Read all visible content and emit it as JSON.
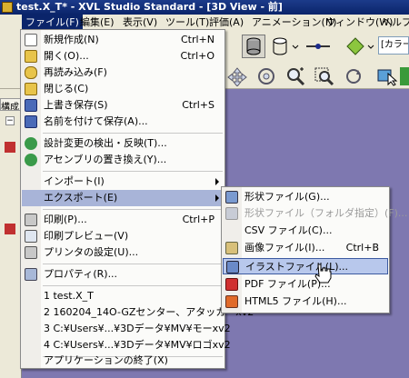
{
  "window": {
    "title": "test.X_T* - XVL Studio Standard - [3D View - 前]"
  },
  "menubar": {
    "items": [
      "ファイル(F)",
      "編集(E)",
      "表示(V)",
      "ツール(T)",
      "評価(A)",
      "アニメーション(N)",
      "ウィンドウ(W)",
      "ヘルプ(H)"
    ]
  },
  "toolbar": {
    "combo_text": "[カラー"
  },
  "side_panel": {
    "tab_label": "構成"
  },
  "file_menu": {
    "items": [
      {
        "label": "新規作成(N)",
        "shortcut": "Ctrl+N"
      },
      {
        "label": "開く(O)...",
        "shortcut": "Ctrl+O"
      },
      {
        "label": "再読み込み(F)",
        "shortcut": ""
      },
      {
        "label": "閉じる(C)",
        "shortcut": ""
      },
      {
        "label": "上書き保存(S)",
        "shortcut": "Ctrl+S"
      },
      {
        "label": "名前を付けて保存(A)...",
        "shortcut": ""
      },
      {
        "label": "設計変更の検出・反映(T)...",
        "shortcut": ""
      },
      {
        "label": "アセンブリの置き換え(Y)...",
        "shortcut": ""
      },
      {
        "label": "インポート(I)",
        "shortcut": ""
      },
      {
        "label": "エクスポート(E)",
        "shortcut": ""
      },
      {
        "label": "印刷(P)...",
        "shortcut": "Ctrl+P"
      },
      {
        "label": "印刷プレビュー(V)",
        "shortcut": ""
      },
      {
        "label": "プリンタの設定(U)...",
        "shortcut": ""
      },
      {
        "label": "プロパティ(R)...",
        "shortcut": ""
      },
      {
        "label": "1 test.X_T",
        "shortcut": ""
      },
      {
        "label": "2 160204_14O-GZセンター、アタッカーxv2",
        "shortcut": ""
      },
      {
        "label": "3 C:¥Users¥...¥3Dデータ¥MV¥モーxv2",
        "shortcut": ""
      },
      {
        "label": "4 C:¥Users¥...¥3Dデータ¥MV¥ロゴxv2",
        "shortcut": ""
      },
      {
        "label": "アプリケーションの終了(X)",
        "shortcut": ""
      }
    ]
  },
  "export_menu": {
    "items": [
      {
        "label": "形状ファイル(G)...",
        "shortcut": ""
      },
      {
        "label": "形状ファイル（フォルダ指定）(F)...",
        "shortcut": ""
      },
      {
        "label": "CSV ファイル(C)...",
        "shortcut": ""
      },
      {
        "label": "画像ファイル(I)...",
        "shortcut": "Ctrl+B"
      },
      {
        "label": "イラストファイル(L)...",
        "shortcut": ""
      },
      {
        "label": "PDF ファイル(P)...",
        "shortcut": ""
      },
      {
        "label": "HTML5 ファイル(H)...",
        "shortcut": ""
      }
    ]
  }
}
